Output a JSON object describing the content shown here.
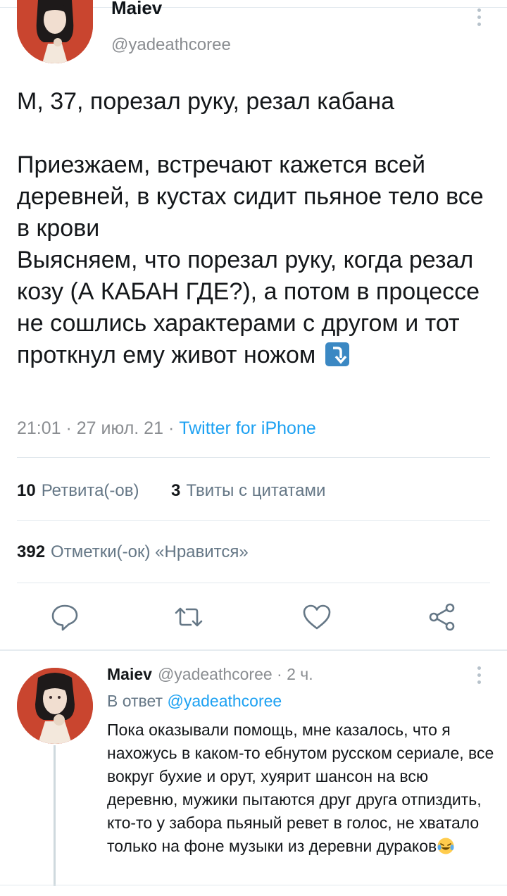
{
  "tweet": {
    "author_name": "Maiev",
    "author_handle": "@yadeathcoree",
    "text_line1": "М, 37, порезал руку, резал кабана",
    "text_body": "Приезжаем, встречают кажется всей деревней, в кустах сидит пьяное тело все в крови\nВыясняем, что порезал руку, когда резал козу (А КАБАН ГДЕ?), а потом в процессе не сошлись характерами с другом и тот проткнул ему живот ножом",
    "time": "21:01",
    "date": "27 июл. 21",
    "source": "Twitter for iPhone",
    "retweets_count": "10",
    "retweets_label": "Ретвита(-ов)",
    "quotes_count": "3",
    "quotes_label": "Твиты с цитатами",
    "likes_count": "392",
    "likes_label": "Отметки(-ок) «Нравится»",
    "arrow_emoji": "arrow-curving-down-icon"
  },
  "actions": {
    "reply": "reply-icon",
    "retweet": "retweet-icon",
    "like": "heart-icon",
    "share": "share-icon"
  },
  "reply": {
    "author_name": "Maiev",
    "author_handle": "@yadeathcoree",
    "time": "2 ч.",
    "in_reply_label": "В ответ",
    "in_reply_handle": "@yadeathcoree",
    "text": "Пока оказывали помощь, мне казалось, что я нахожусь в каком-то ебнутом русском сериале, все вокруг бухие и орут, хуярит шансон на всю деревню, мужики пытаются друг друга отпиздить, кто-то у забора пьяный ревет в голос, не хватало только на фоне музыки из деревни дураков"
  },
  "colors": {
    "accent": "#1da1f2",
    "muted": "#8a8d91",
    "divider": "#e1e8ed",
    "avatar_bg": "#c9452f"
  }
}
